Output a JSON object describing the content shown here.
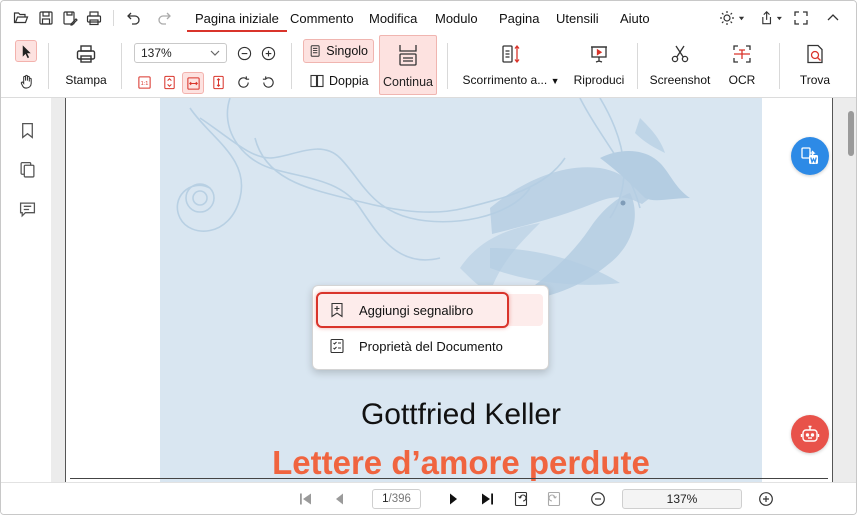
{
  "menu": {
    "tabs": [
      "Pagina iniziale",
      "Commento",
      "Modifica",
      "Modulo",
      "Pagina",
      "Utensili",
      "Aiuto"
    ],
    "active_tab": "Pagina iniziale"
  },
  "ribbon": {
    "print_label": "Stampa",
    "zoom_value": "137%",
    "single_label": "Singolo",
    "double_label": "Doppia",
    "continuous_label": "Continua",
    "scroll_label": "Scorrimento a...",
    "play_label": "Riproduci",
    "screenshot_label": "Screenshot",
    "ocr_label": "OCR",
    "find_label": "Trova"
  },
  "document": {
    "author": "Gottfried Keller",
    "title": "Lettere d’amore perdute"
  },
  "context_menu": {
    "add_bookmark": "Aggiungi segnalibro",
    "doc_properties": "Proprietà del Documento"
  },
  "bottom": {
    "current_page": "1",
    "total_pages": "/396",
    "zoom": "137%"
  },
  "colors": {
    "accent": "#d9342b",
    "title": "#f0643f",
    "cover_bg": "#d9e6f1",
    "convert_fab": "#2d8ae6",
    "ai_fab": "#e8524a"
  }
}
